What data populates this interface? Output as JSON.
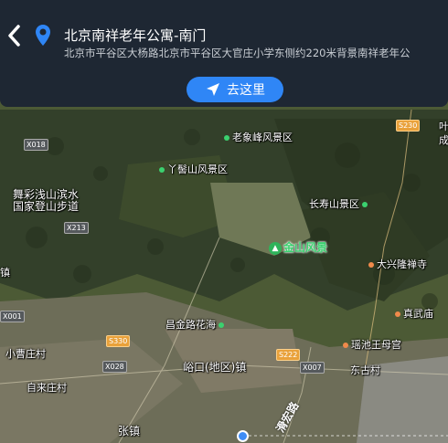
{
  "header": {
    "title": "北京南祥老年公寓-南门",
    "address": "北京市平谷区大杨路北京市平谷区大官庄小学东侧约220米背景南祥老年公",
    "go_label": "去这里"
  },
  "icons": {
    "back": "back-arrow-icon",
    "pin": "location-pin-icon",
    "navigate": "navigate-arrow-icon"
  },
  "colors": {
    "accent": "#2f86f6",
    "header_bg": "#1e2733",
    "poi_green": "#3bd16f"
  },
  "map": {
    "pois": [
      {
        "name": "老象峰风景区"
      },
      {
        "name": "丫髻山风景区"
      },
      {
        "name": "舞彩浅山滨水"
      },
      {
        "name": "国家登山步道"
      },
      {
        "name": "长寿山景区"
      },
      {
        "name": "大兴隆禅寺"
      },
      {
        "name": "真武庙"
      },
      {
        "name": "昌金路花海"
      },
      {
        "name": "瑶池王母宫"
      },
      {
        "name": "东古村"
      },
      {
        "name": "小曹庄村"
      },
      {
        "name": "自来庄村"
      },
      {
        "name": "峪口(地区)镇"
      },
      {
        "name": "张镇"
      },
      {
        "name": "镇"
      },
      {
        "name": "叶"
      },
      {
        "name": "成"
      }
    ],
    "scenic": "金山风景",
    "roads": [
      "X018",
      "X213",
      "X001",
      "S330",
      "X028",
      "S222",
      "X007",
      "S230"
    ],
    "road_name": "滑宏路"
  }
}
